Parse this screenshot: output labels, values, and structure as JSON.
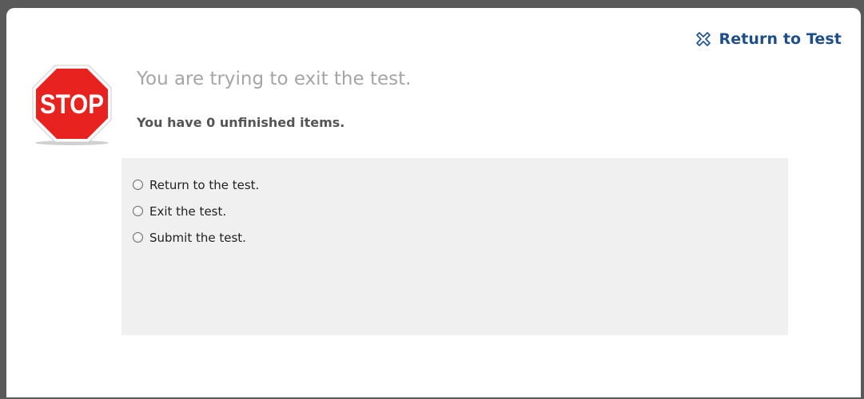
{
  "dialog": {
    "return_link_label": "Return to Test",
    "return_link_icon": "close-icon",
    "stop_sign_text": "STOP",
    "stop_sign_color": "#e8231f",
    "headline": "You are trying to exit the test.",
    "subline": "You have 0 unfinished items.",
    "link_color": "#1f4f8a"
  },
  "options": [
    {
      "label": "Return to the test.",
      "selected": false
    },
    {
      "label": "Exit the test.",
      "selected": false
    },
    {
      "label": "Submit the test.",
      "selected": false
    }
  ]
}
